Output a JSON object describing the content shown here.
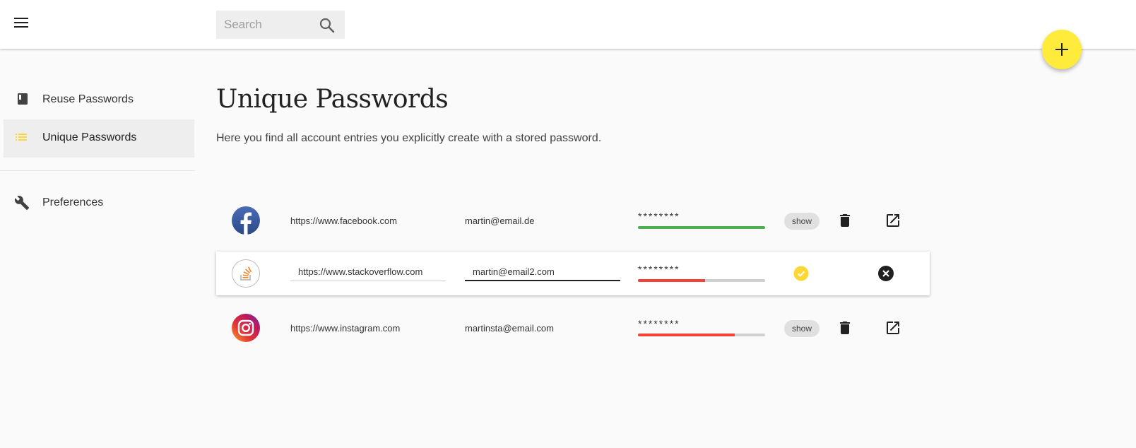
{
  "header": {
    "menu_icon": "menu-icon",
    "search": {
      "placeholder": "Search",
      "value": "",
      "icon": "search-icon"
    },
    "fab": {
      "icon": "plus-icon",
      "color": "#ffeb3b"
    }
  },
  "sidebar": {
    "items": [
      {
        "label": "Reuse Passwords",
        "icon": "book-icon",
        "active": false
      },
      {
        "label": "Unique Passwords",
        "icon": "list-icon",
        "active": true,
        "icon_color": "#ffeb3b"
      },
      {
        "label": "Preferences",
        "icon": "wrench-icon",
        "active": false
      }
    ]
  },
  "main": {
    "title": "Unique Passwords",
    "description": "Here you find all account entries you explicitly create with a stored password."
  },
  "entries": [
    {
      "logo": "facebook-logo",
      "url": "https://www.facebook.com",
      "username": "martin@email.de",
      "password_masked": "********",
      "strength": 1.0,
      "strength_color": "#4caf50",
      "show_label": "show",
      "editing": false
    },
    {
      "logo": "stackoverflow-logo",
      "url": "https://www.stackoverflow.com",
      "username": "martin@email2.com",
      "password_masked": "********",
      "strength": 0.53,
      "strength_color": "#f44336",
      "editing": true,
      "confirm_icon": "check-circle-icon",
      "cancel_icon": "cancel-circle-icon"
    },
    {
      "logo": "instagram-logo",
      "url": "https://www.instagram.com",
      "username": "martinsta@email.com",
      "password_masked": "********",
      "strength": 0.76,
      "strength_color": "#f44336",
      "show_label": "show",
      "editing": false
    }
  ],
  "colors": {
    "accent": "#ffeb3b",
    "strong": "#4caf50",
    "weak": "#f44336"
  }
}
